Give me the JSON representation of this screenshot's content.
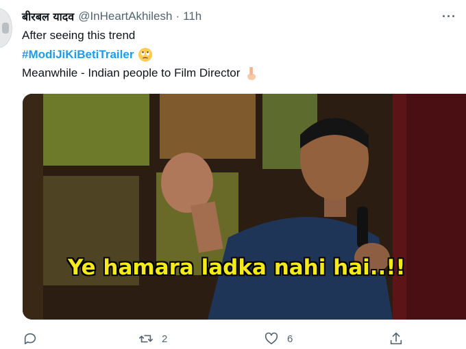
{
  "tweet": {
    "author_name": "बीरबल यादव",
    "author_handle": "@InHeartAkhilesh",
    "separator": "·",
    "timestamp": "11h",
    "more_label": "···",
    "lines": {
      "line1": "After seeing this trend",
      "hashtag": "#ModiJiKiBetiTrailer",
      "line3": "Meanwhile - Indian people to Film Director"
    },
    "media": {
      "caption": "Ye hamara ladka nahi hai..!!"
    },
    "actions": {
      "reply_count": "",
      "retweet_count": "2",
      "like_count": "6"
    }
  },
  "colors": {
    "link": "#1d9bf0",
    "secondary_text": "#536471",
    "caption": "#f4ea1a"
  },
  "icons": [
    "reply-icon",
    "retweet-icon",
    "like-icon",
    "share-icon",
    "rolling-eyes-emoji-icon",
    "pointing-down-emoji-icon",
    "more-icon"
  ]
}
